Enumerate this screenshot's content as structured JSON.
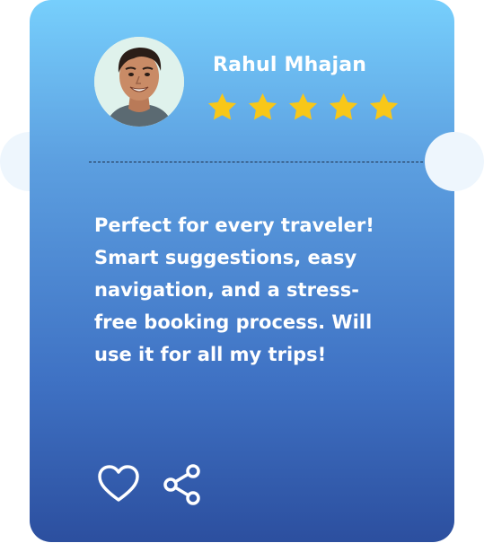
{
  "testimonial": {
    "name": "Rahul Mhajan",
    "rating": 5,
    "rating_max": 5,
    "quote": "Perfect for every traveler! Smart suggestions, easy navigation, and a stress-free booking process. Will use it for all my trips!"
  },
  "icons": {
    "avatar": "user-photo",
    "star": "star-icon",
    "like": "heart-icon",
    "share": "share-icon"
  },
  "colors": {
    "card_top": "#77cffc",
    "card_bottom": "#2c4f9f",
    "star": "#f8c718",
    "text": "#ffffff",
    "notch": "#eef6fd"
  }
}
